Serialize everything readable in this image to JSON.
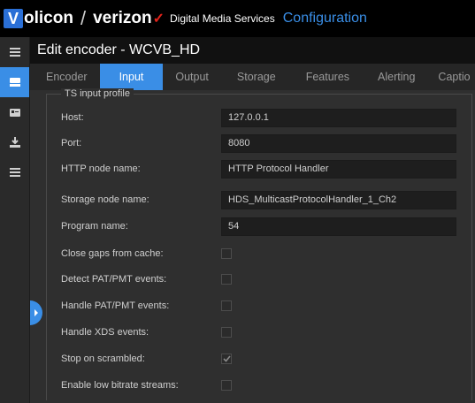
{
  "brand": {
    "v": "V",
    "olicon": "olicon",
    "verizon": "verizon",
    "check": "✓",
    "dms": "Digital Media Services",
    "config": "Configuration"
  },
  "title": "Edit encoder - WCVB_HD",
  "tabs": [
    "Encoder",
    "Input",
    "Output",
    "Storage",
    "Features",
    "Alerting",
    "Captio"
  ],
  "active_tab": "Input",
  "section_legend": "TS input profile",
  "fields": {
    "host": {
      "label": "Host:",
      "value": "127.0.0.1"
    },
    "port": {
      "label": "Port:",
      "value": "8080"
    },
    "http_node": {
      "label": "HTTP node name:",
      "value": "HTTP Protocol Handler"
    },
    "storage_node": {
      "label": "Storage node name:",
      "value": "HDS_MulticastProtocolHandler_1_Ch2"
    },
    "program": {
      "label": "Program name:",
      "value": "54"
    }
  },
  "checks": {
    "close_gaps": {
      "label": "Close gaps from cache:",
      "checked": false
    },
    "detect_pat": {
      "label": "Detect PAT/PMT events:",
      "checked": false
    },
    "handle_pat": {
      "label": "Handle PAT/PMT events:",
      "checked": false
    },
    "handle_xds": {
      "label": "Handle XDS events:",
      "checked": false
    },
    "stop_scrambled": {
      "label": "Stop on scrambled:",
      "checked": true
    },
    "low_bitrate": {
      "label": "Enable low bitrate streams:",
      "checked": false
    }
  },
  "icons": {
    "menu": "hamburger-menu-icon",
    "encoder": "encoder-icon",
    "card": "id-card-icon",
    "download": "download-icon",
    "list": "list-icon",
    "handle": "chevron-right-icon"
  },
  "colors": {
    "accent": "#3a8ee6",
    "verizon_red": "#e2231a",
    "background": "#2f2f2f"
  }
}
